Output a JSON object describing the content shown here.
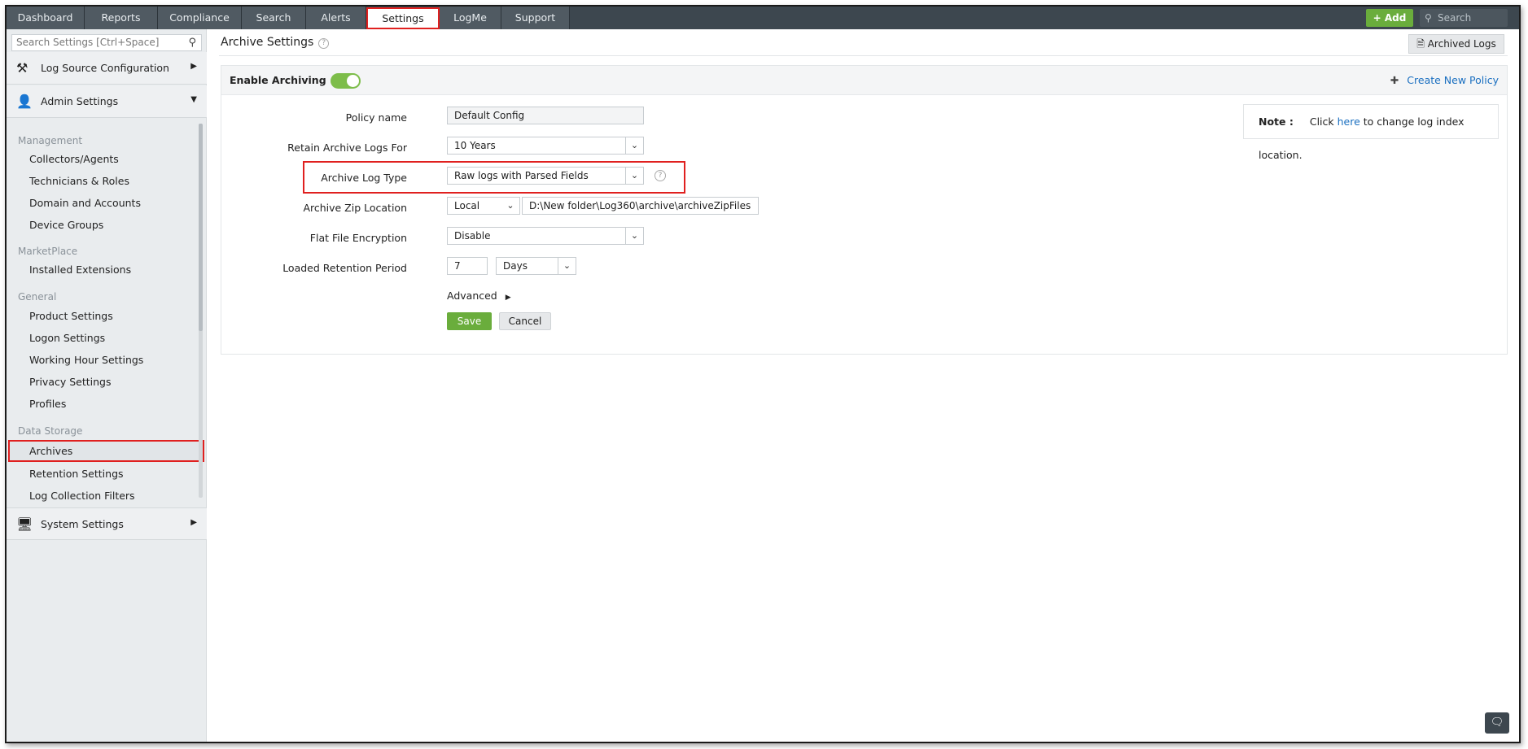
{
  "nav": {
    "tabs": [
      "Dashboard",
      "Reports",
      "Compliance",
      "Search",
      "Alerts",
      "Settings",
      "LogMe",
      "Support"
    ],
    "active_tab": "Settings",
    "add_label": "+ Add",
    "search_placeholder": "Search"
  },
  "sidebar": {
    "search_placeholder": "Search Settings [Ctrl+Space]",
    "sections": {
      "log_source": "Log Source Configuration",
      "admin": "Admin Settings",
      "system": "System Settings"
    },
    "groups": {
      "management": "Management",
      "marketplace": "MarketPlace",
      "general": "General",
      "data_storage": "Data Storage"
    },
    "items": {
      "collectors": "Collectors/Agents",
      "technicians": "Technicians & Roles",
      "domain": "Domain and Accounts",
      "device_groups": "Device Groups",
      "installed_ext": "Installed Extensions",
      "product_settings": "Product Settings",
      "logon_settings": "Logon Settings",
      "working_hour": "Working Hour Settings",
      "privacy": "Privacy Settings",
      "profiles": "Profiles",
      "archives": "Archives",
      "retention": "Retention Settings",
      "log_filters": "Log Collection Filters"
    },
    "active_item": "Archives"
  },
  "main": {
    "title": "Archive Settings",
    "archived_logs_label": "Archived Logs",
    "enable_archiving_label": "Enable Archiving",
    "enable_archiving_on": true,
    "create_policy_label": "Create New Policy",
    "form": {
      "policy_name_label": "Policy name",
      "policy_name_value": "Default Config",
      "retain_label": "Retain Archive Logs For",
      "retain_value": "10 Years",
      "log_type_label": "Archive Log Type",
      "log_type_value": "Raw logs with Parsed Fields",
      "zip_location_label": "Archive Zip Location",
      "zip_location_type": "Local",
      "zip_location_path": "D:\\New folder\\Log360\\archive\\archiveZipFiles",
      "encryption_label": "Flat File Encryption",
      "encryption_value": "Disable",
      "retention_label": "Loaded Retention Period",
      "retention_number": "7",
      "retention_unit": "Days",
      "advanced_label": "Advanced",
      "save_label": "Save",
      "cancel_label": "Cancel"
    },
    "note": {
      "label": "Note :",
      "prefix": "Click",
      "link": "here",
      "suffix": "to change log index location."
    }
  },
  "colors": {
    "accent_green": "#6aad3c",
    "nav_bg": "#3d474f",
    "highlight_red": "#e0201f",
    "link_blue": "#1a6fc0"
  }
}
